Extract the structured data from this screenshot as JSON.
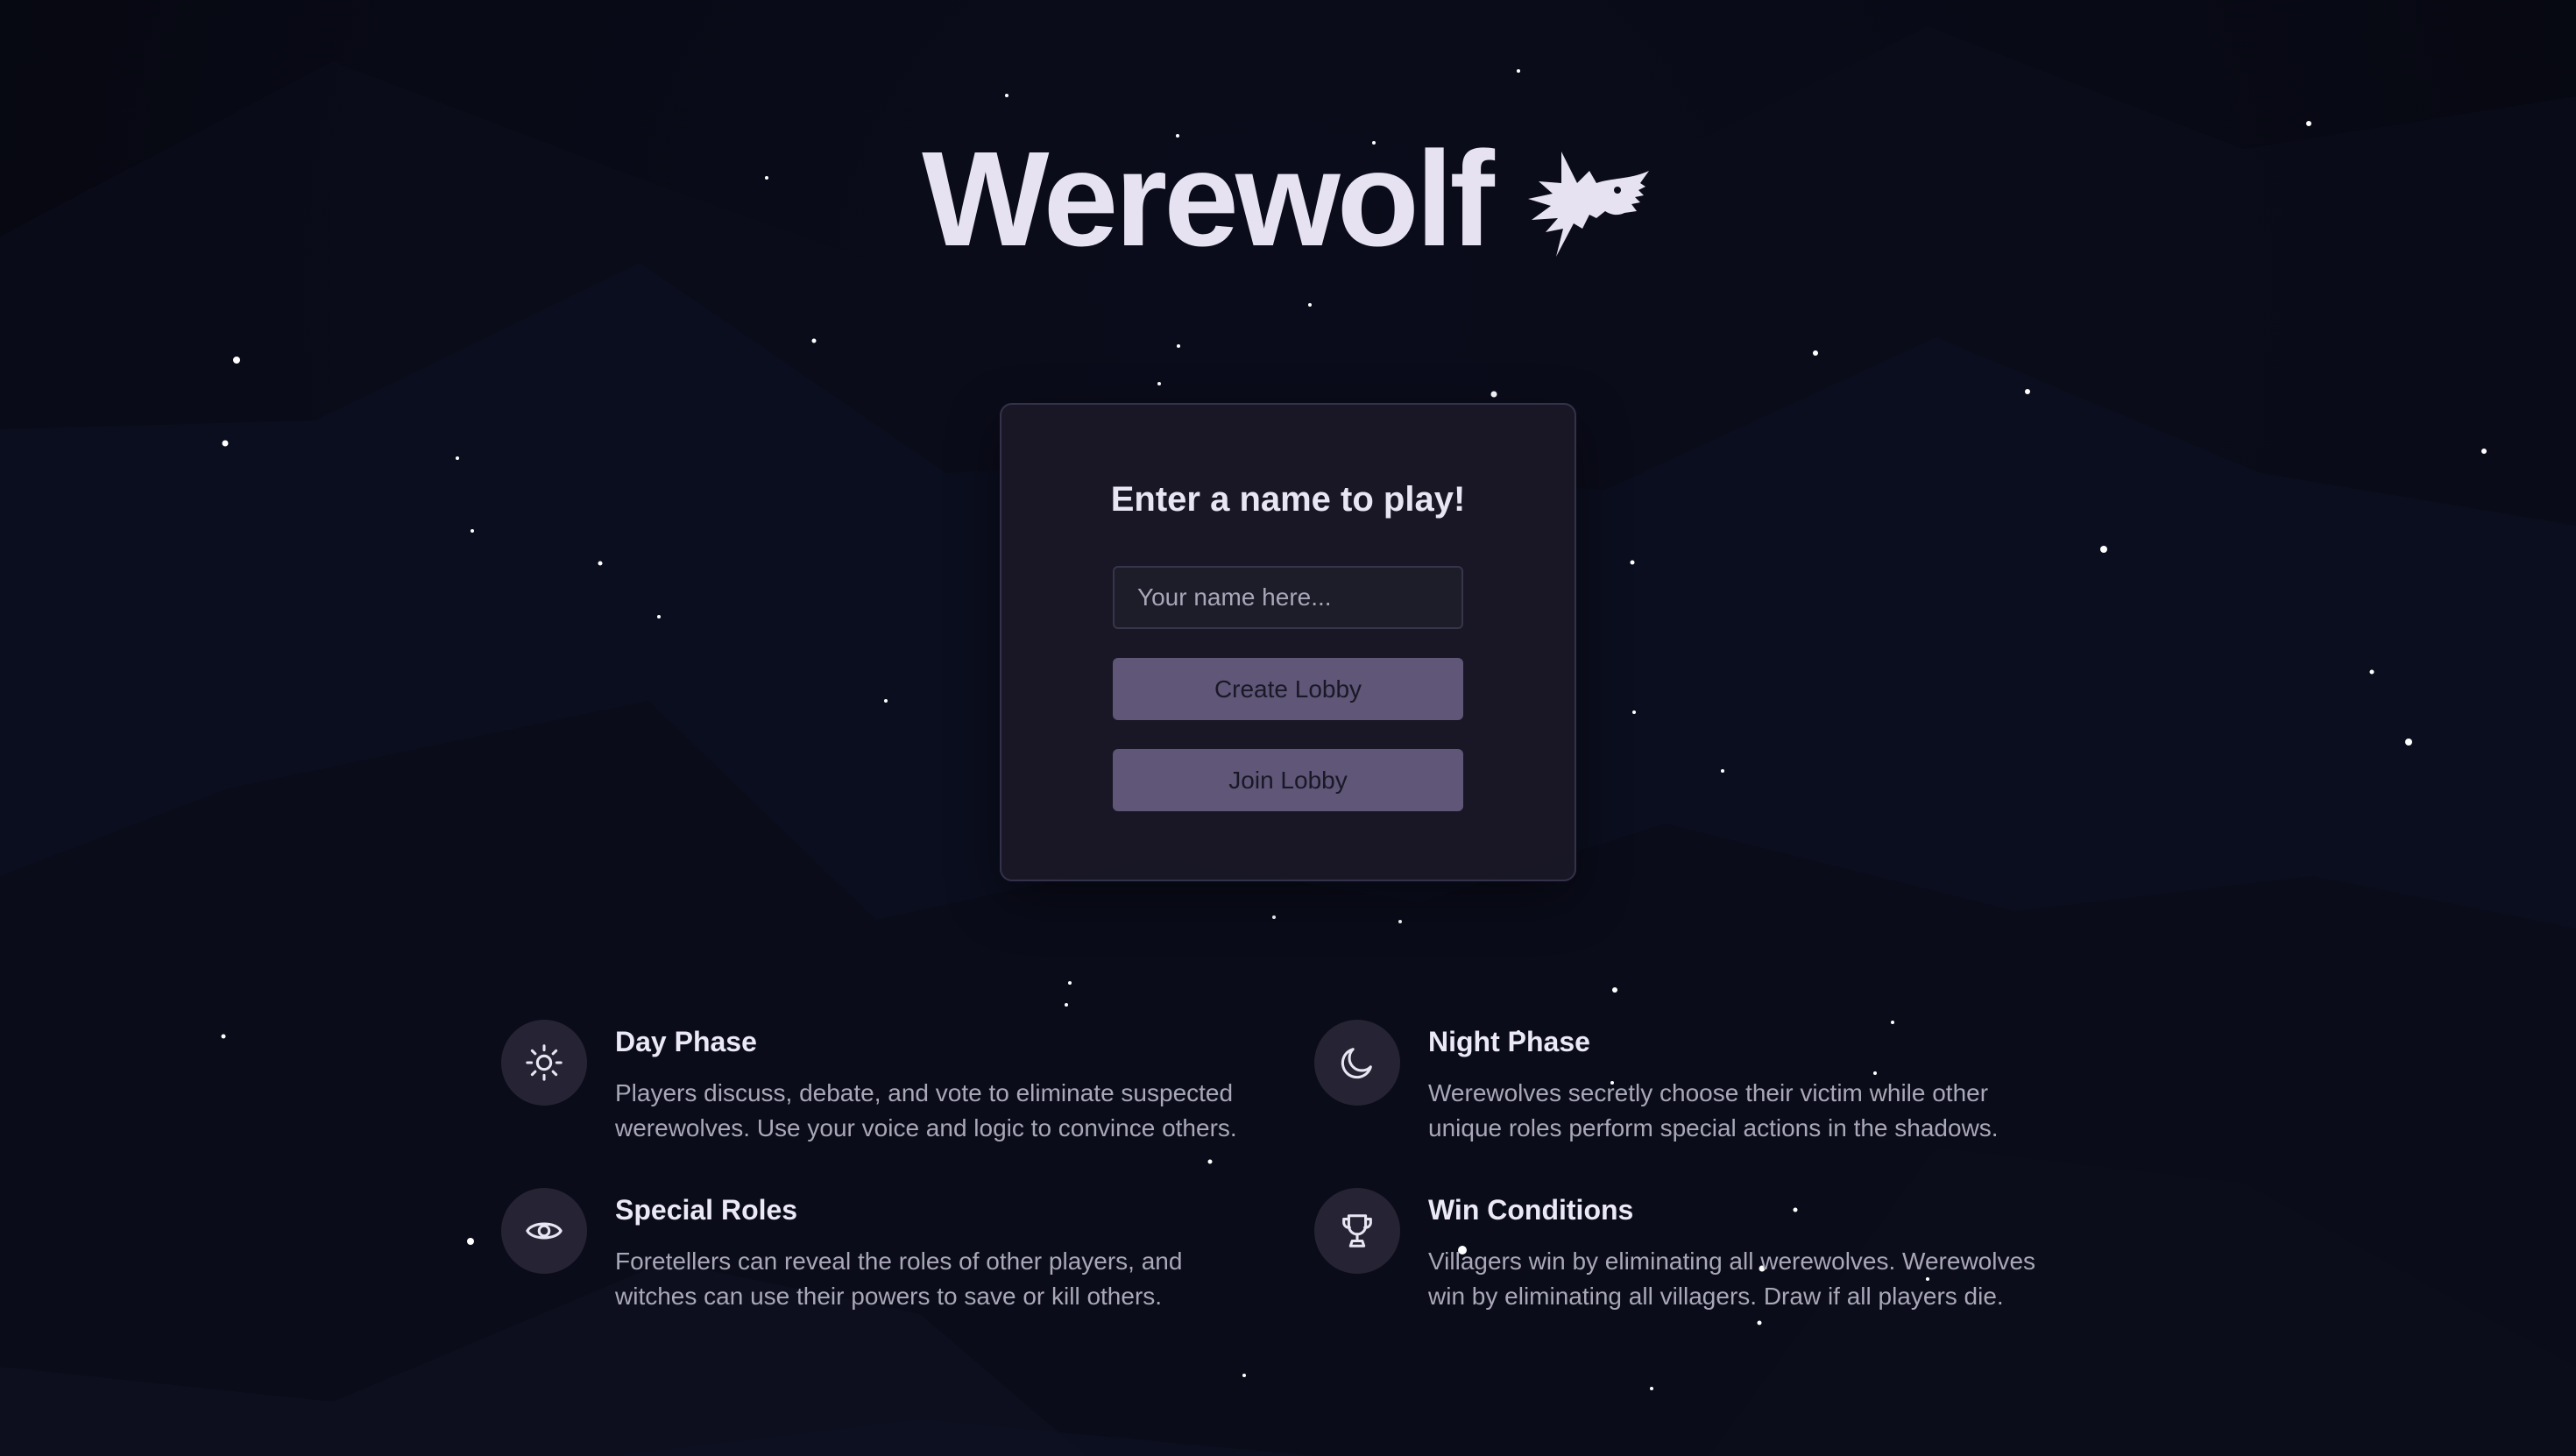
{
  "app": {
    "title": "Werewolf",
    "logo_icon": "wolf-head-icon"
  },
  "colors": {
    "background": "#06070f",
    "title": "#e6e2f2",
    "card_bg": "#1c1a28",
    "button_bg": "#5f5678",
    "button_text": "#1a1826",
    "feature_title": "#ece9f6",
    "feature_text": "#a9a7b8"
  },
  "card": {
    "heading": "Enter a name to play!",
    "name_input": {
      "value": "",
      "placeholder": "Your name here..."
    },
    "create_label": "Create Lobby",
    "join_label": "Join Lobby"
  },
  "features": [
    {
      "icon": "sun-icon",
      "title": "Day Phase",
      "description": "Players discuss, debate, and vote to eliminate suspected werewolves. Use your voice and logic to convince others."
    },
    {
      "icon": "moon-icon",
      "title": "Night Phase",
      "description": "Werewolves secretly choose their victim while other unique roles perform special actions in the shadows."
    },
    {
      "icon": "eye-icon",
      "title": "Special Roles",
      "description": "Foretellers can reveal the roles of other players, and witches can use their powers to save or kill others."
    },
    {
      "icon": "trophy-icon",
      "title": "Win Conditions",
      "description": "Villagers win by eliminating all werewolves. Werewolves win by eliminating all villagers. Draw if all players die."
    }
  ]
}
